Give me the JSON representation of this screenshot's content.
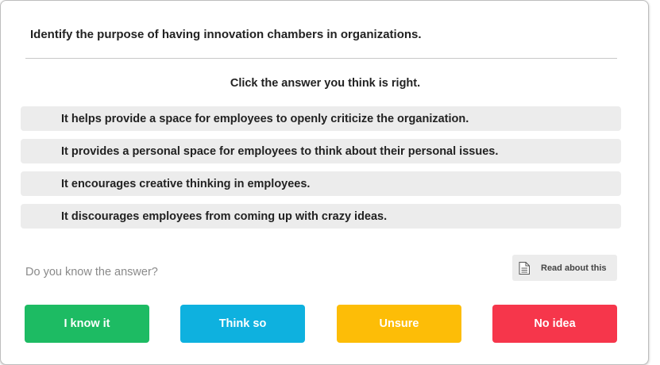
{
  "question": "Identify the purpose of having innovation chambers in organizations.",
  "instruction": "Click the answer you think is right.",
  "options": [
    "It helps provide a space for employees to openly criticize the organization.",
    "It provides a personal space for employees to think about their personal issues.",
    "It encourages creative thinking in employees.",
    "It discourages employees from coming up with crazy ideas."
  ],
  "confidence_prompt": "Do you know the answer?",
  "read_about": {
    "label": "Read about this",
    "icon": "document-icon"
  },
  "confidence_buttons": [
    {
      "label": "I know it",
      "color": "#1dbb63"
    },
    {
      "label": "Think so",
      "color": "#0eb1df"
    },
    {
      "label": "Unsure",
      "color": "#fdbd07"
    },
    {
      "label": "No idea",
      "color": "#f6364b"
    }
  ]
}
